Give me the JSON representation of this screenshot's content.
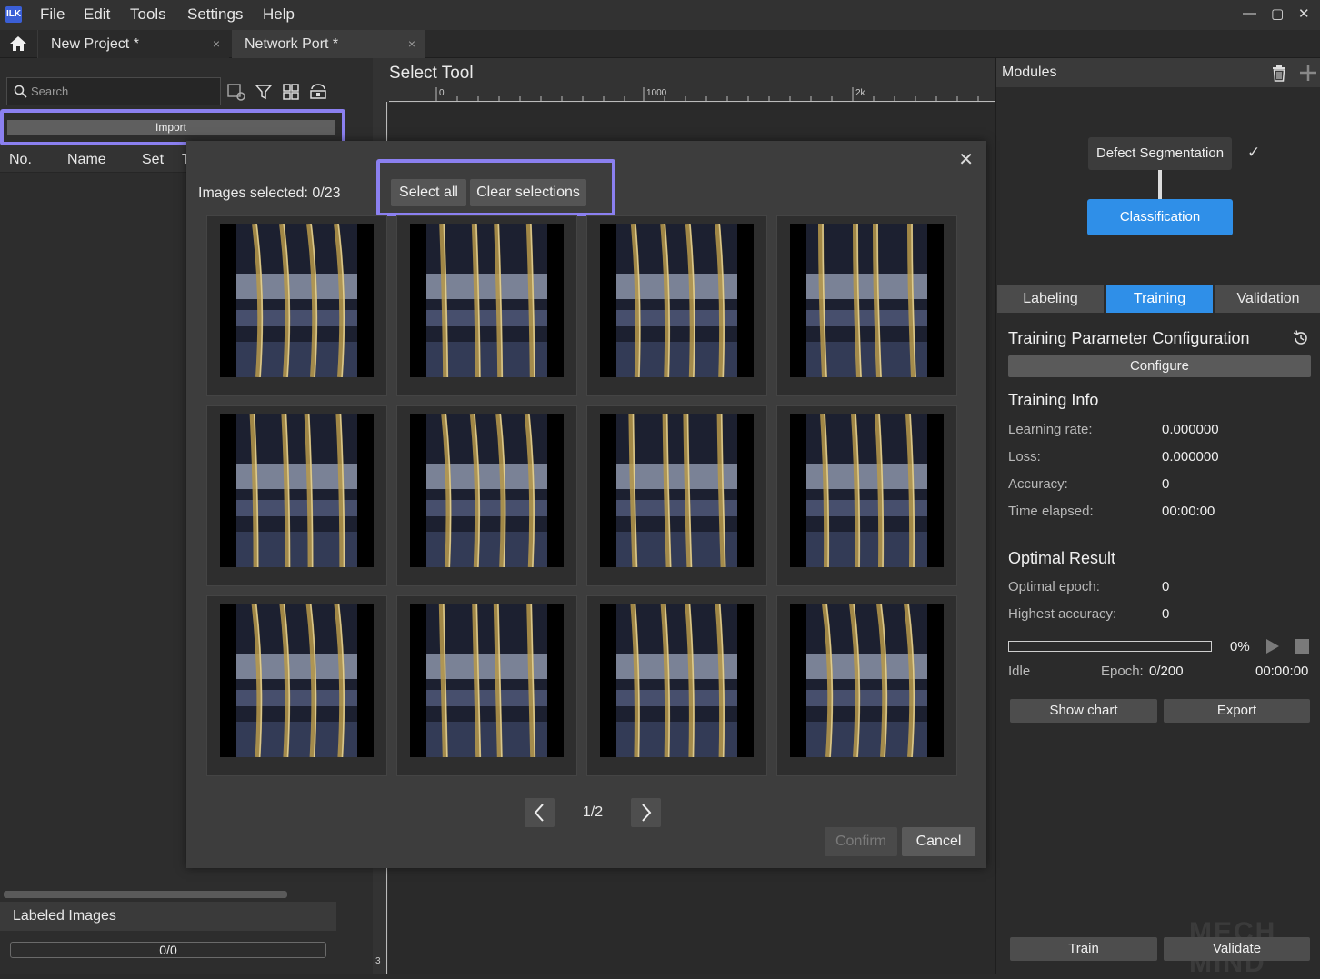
{
  "menubar": {
    "logo": "ILK",
    "items": [
      "File",
      "Edit",
      "Tools",
      "Settings",
      "Help"
    ],
    "window_controls": [
      "—",
      "▢",
      "✕"
    ]
  },
  "tabs": [
    {
      "label": "New Project *",
      "close": "×"
    },
    {
      "label": "Network Port *",
      "close": "×"
    }
  ],
  "left": {
    "search_placeholder": "Search",
    "import_label": "Import",
    "columns": [
      "No.",
      "Name",
      "Set",
      "T"
    ],
    "labeled_images_label": "Labeled Images",
    "labeled_count": "0/0"
  },
  "center": {
    "title": "Select Tool",
    "ruler_labels": [
      "0",
      "1000",
      "2k"
    ],
    "vertical_ruler_label": "3"
  },
  "right": {
    "modules_title": "Modules",
    "defect_module": "Defect Segmentation",
    "classification_module": "Classification",
    "tabs": [
      {
        "label": "Labeling",
        "active": false
      },
      {
        "label": "Training",
        "active": true
      },
      {
        "label": "Validation",
        "active": false
      }
    ],
    "training_param_title": "Training Parameter Configuration",
    "configure_label": "Configure",
    "training_info_title": "Training Info",
    "training_info": [
      {
        "label": "Learning rate:",
        "value": "0.000000"
      },
      {
        "label": "Loss:",
        "value": "0.000000"
      },
      {
        "label": "Accuracy:",
        "value": "0"
      },
      {
        "label": "Time elapsed:",
        "value": "00:00:00"
      }
    ],
    "optimal_title": "Optimal Result",
    "optimal": [
      {
        "label": "Optimal epoch:",
        "value": "0"
      },
      {
        "label": "Highest accuracy:",
        "value": "0"
      }
    ],
    "progress_percent": "0%",
    "progress_fraction": 0,
    "status": "Idle",
    "epoch_label": "Epoch:",
    "epoch_value": "0/200",
    "time": "00:00:00",
    "show_chart_label": "Show chart",
    "export_label": "Export",
    "train_label": "Train",
    "validate_label": "Validate",
    "watermark": "MECH MIND"
  },
  "dialog": {
    "images_selected_label": "Images selected:",
    "images_selected_value": "0/23",
    "select_all_label": "Select all",
    "clear_selections_label": "Clear selections",
    "page_indicator": "1/2",
    "confirm_label": "Confirm",
    "cancel_label": "Cancel",
    "close": "✕",
    "thumbnail_count": 12
  },
  "colors": {
    "accent_blue": "#2f8fe8",
    "highlight_purple": "#8b80f0"
  }
}
